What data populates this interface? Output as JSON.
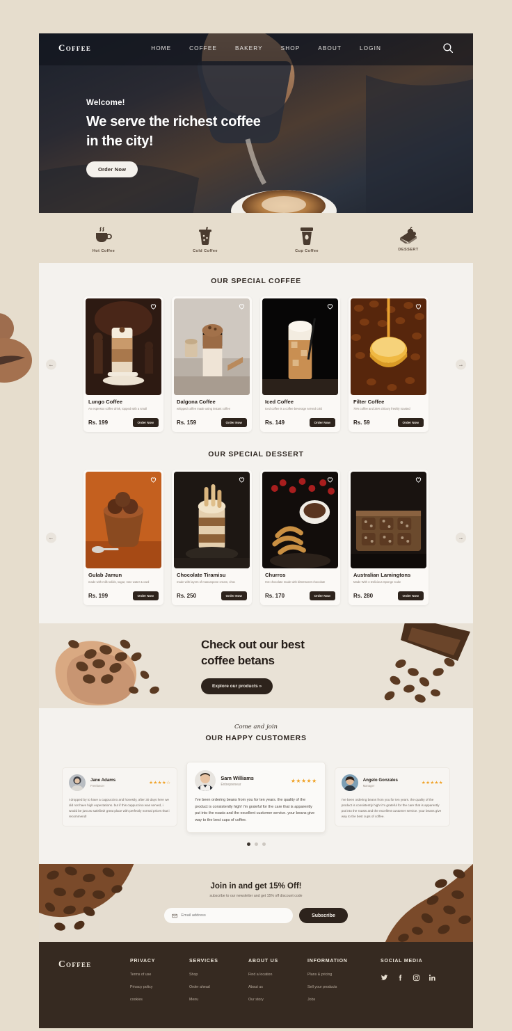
{
  "brand": "Coffee",
  "nav": {
    "links": [
      "HOME",
      "COFFEE",
      "BAKERY",
      "SHOP",
      "ABOUT",
      "LOGIN"
    ],
    "search_icon": "search-icon"
  },
  "hero": {
    "welcome": "Welcome!",
    "headline_line1": "We serve the richest coffee",
    "headline_line2": "in the city!",
    "cta": "Order Now"
  },
  "categories": [
    {
      "label": "Hot Coffee",
      "icon": "hot-coffee-icon"
    },
    {
      "label": "Cold Coffee",
      "icon": "cold-coffee-icon"
    },
    {
      "label": "Cup Coffee",
      "icon": "cup-coffee-icon"
    },
    {
      "label": "DESSERT",
      "icon": "dessert-icon"
    }
  ],
  "coffee_section": {
    "title": "OUR SPECIAL COFFEE",
    "prev_label": "←",
    "next_label": "→",
    "items": [
      {
        "name": "Lungo Coffee",
        "desc": "An espresso coffee drink, topped with a small",
        "price": "Rs. 199",
        "cta": "Order Now"
      },
      {
        "name": "Dalgona Coffee",
        "desc": "whipped coffee made using instant coffee",
        "price": "Rs. 159",
        "cta": "Order Now"
      },
      {
        "name": "Iced Coffee",
        "desc": "Iced coffee is a coffee beverage served cold",
        "price": "Rs. 149",
        "cta": "Order Now"
      },
      {
        "name": "Filter Coffee",
        "desc": "75% coffee and 25% chicory freshly roasted",
        "price": "Rs. 59",
        "cta": "Order Now"
      }
    ]
  },
  "dessert_section": {
    "title": "OUR SPECIAL DESSERT",
    "prev_label": "←",
    "next_label": "→",
    "items": [
      {
        "name": "Gulab Jamun",
        "desc": "made with milk solids, sugar, rose water & card",
        "price": "Rs. 199",
        "cta": "Order Now"
      },
      {
        "name": "Chocolate Tiramisu",
        "desc": "made with layers of mascarpone cream, choc",
        "price": "Rs. 250",
        "cta": "Order Now"
      },
      {
        "name": "Churros",
        "desc": "Hot chocolate made with bittersweet chocolate",
        "price": "Rs. 170",
        "cta": "Order Now"
      },
      {
        "name": "Australian Lamingtons",
        "desc": "Made With A Delicious Sponge Cake",
        "price": "Rs. 280",
        "cta": "Order Now"
      }
    ]
  },
  "beans_cta": {
    "line1": "Check out our best",
    "line2": "coffee betans",
    "button": "Explore our products »"
  },
  "testimonials": {
    "eyebrow": "Come and join",
    "title": "OUR HAPPY CUSTOMERS",
    "items": [
      {
        "name": "Jane Adams",
        "role": "Freelancer",
        "stars": "★★★★☆",
        "text": "I dropped by to have a cappuccino and honestly, after 30 days here we did not have high expectations. but if this cappuccino was served, i would be just as satisfied! great place with perfectly normal prices that i recommend!"
      },
      {
        "name": "Sam Williams",
        "role": "Entrepreneur",
        "stars": "★★★★★",
        "text": "I've been ordering beans from you for ten years. the quality of the product is consistently high! i'm grateful for the care that is apparently put into the roasts and the excellent customer service. your beans give way to the best cups of coffee."
      },
      {
        "name": "Angelo Gonzales",
        "role": "Manager",
        "stars": "★★★★★",
        "text": "I've been ordering beans from you for ten years. the quality of the product is consistently high! i'm grateful for the care that is apparently put into the roasts and the excellent customer service. your beans give way to the best cups of coffee."
      }
    ],
    "dots": 3,
    "active_dot": 0
  },
  "newsletter": {
    "title": "Join in and get 15% Off!",
    "subtitle": "subscribe to our newsletter and get 15% off discount code",
    "email_placeholder": "Email address",
    "email_value": "",
    "button": "Subscribe",
    "mail_icon": "mail-icon"
  },
  "footer": {
    "brand": "Coffee",
    "columns": [
      {
        "heading": "PRIVACY",
        "links": [
          "Terms of use",
          "Privacy policy",
          "cookies"
        ]
      },
      {
        "heading": "SERVICES",
        "links": [
          "Shop",
          "Order ahead",
          "Menu"
        ]
      },
      {
        "heading": "ABOUT US",
        "links": [
          "Find a location",
          "About us",
          "Our story"
        ]
      },
      {
        "heading": "INFORMATION",
        "links": [
          "Plans & pricing",
          "Sell your products",
          "Jobs"
        ]
      }
    ],
    "social_heading": "SOCIAL MEDIA",
    "socials": [
      "twitter-icon",
      "facebook-icon",
      "instagram-icon",
      "linkedin-icon"
    ]
  },
  "colors": {
    "page_bg": "#e6ddcd",
    "panel_bg": "#f4f2ee",
    "dark": "#2d231c",
    "footer": "#362a21",
    "star": "#f0a124"
  }
}
